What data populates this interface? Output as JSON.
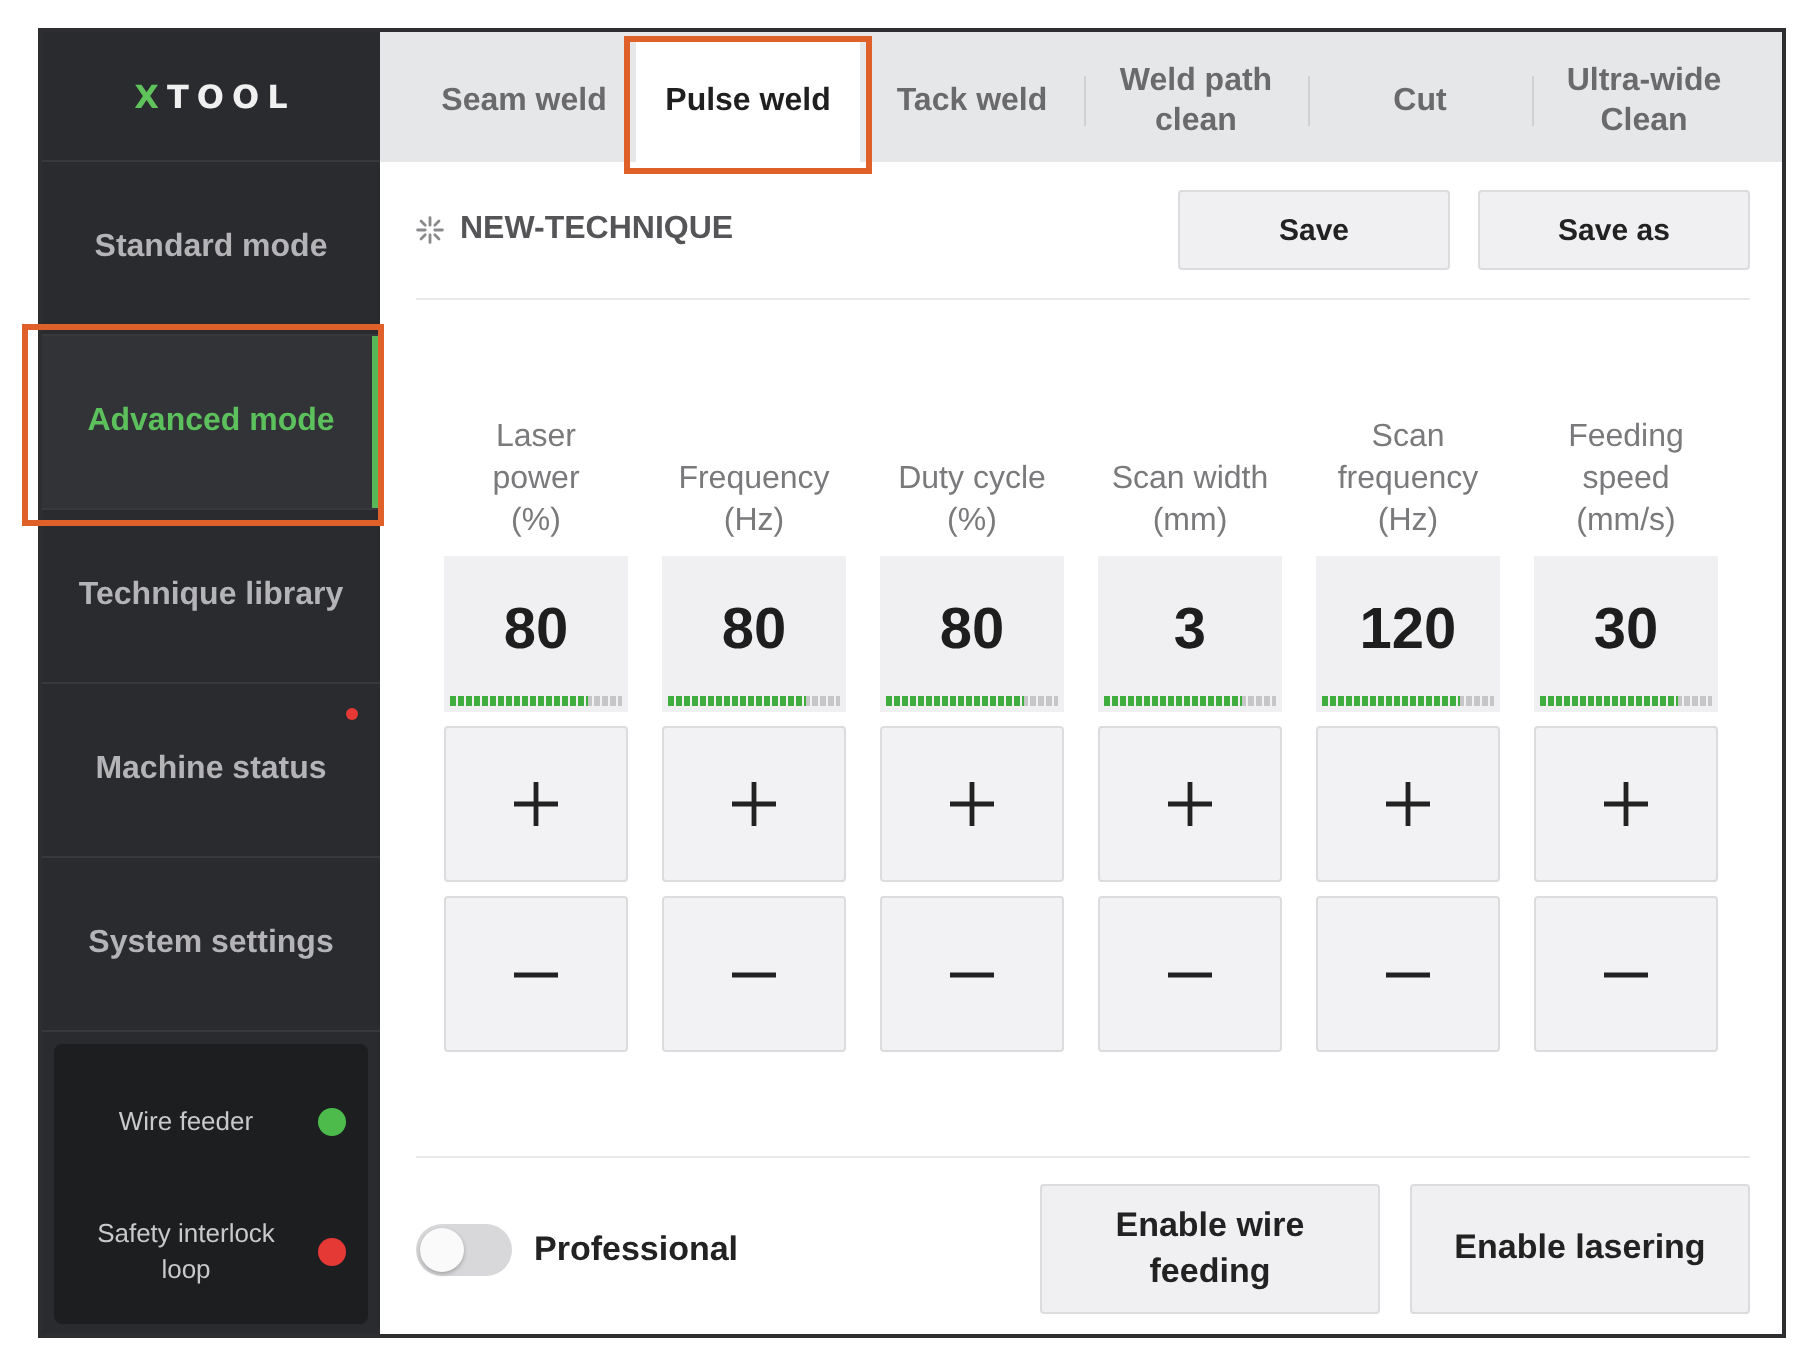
{
  "sidebar": {
    "logo": "XTOOL",
    "items": [
      {
        "label": "Standard mode",
        "selected": false,
        "highlighted": false,
        "alert": false
      },
      {
        "label": "Advanced mode",
        "selected": true,
        "highlighted": true,
        "alert": false
      },
      {
        "label": "Technique library",
        "selected": false,
        "highlighted": false,
        "alert": false
      },
      {
        "label": "Machine status",
        "selected": false,
        "highlighted": false,
        "alert": true
      },
      {
        "label": "System settings",
        "selected": false,
        "highlighted": false,
        "alert": false
      }
    ],
    "status": [
      {
        "label": "Wire feeder",
        "color": "#4cbb4c"
      },
      {
        "label": "Safety interlock loop",
        "color": "#e53935"
      }
    ]
  },
  "tabs": [
    {
      "label": "Seam weld",
      "selected": false,
      "highlighted": false
    },
    {
      "label": "Pulse weld",
      "selected": true,
      "highlighted": true
    },
    {
      "label": "Tack weld",
      "selected": false,
      "highlighted": false
    },
    {
      "label": "Weld path clean",
      "selected": false,
      "highlighted": false
    },
    {
      "label": "Cut",
      "selected": false,
      "highlighted": false
    },
    {
      "label": "Ultra-wide Clean",
      "selected": false,
      "highlighted": false
    }
  ],
  "technique": {
    "name": "NEW-TECHNIQUE",
    "buttons": [
      "Save",
      "Save as"
    ]
  },
  "params": [
    {
      "label": "Laser power",
      "unit": "(%)",
      "value": "80",
      "level": 0.8
    },
    {
      "label": "Frequency",
      "unit": "(Hz)",
      "value": "80",
      "level": 0.8
    },
    {
      "label": "Duty cycle",
      "unit": "(%)",
      "value": "80",
      "level": 0.8
    },
    {
      "label": "Scan width",
      "unit": "(mm)",
      "value": "3",
      "level": 0.8
    },
    {
      "label": "Scan frequency",
      "unit": "(Hz)",
      "value": "120",
      "level": 0.8
    },
    {
      "label": "Feeding speed",
      "unit": "(mm/s)",
      "value": "30",
      "level": 0.8
    }
  ],
  "footer": {
    "toggle": {
      "label": "Professional",
      "on": false
    },
    "buttons": [
      "Enable wire feeding",
      "Enable lasering"
    ]
  }
}
